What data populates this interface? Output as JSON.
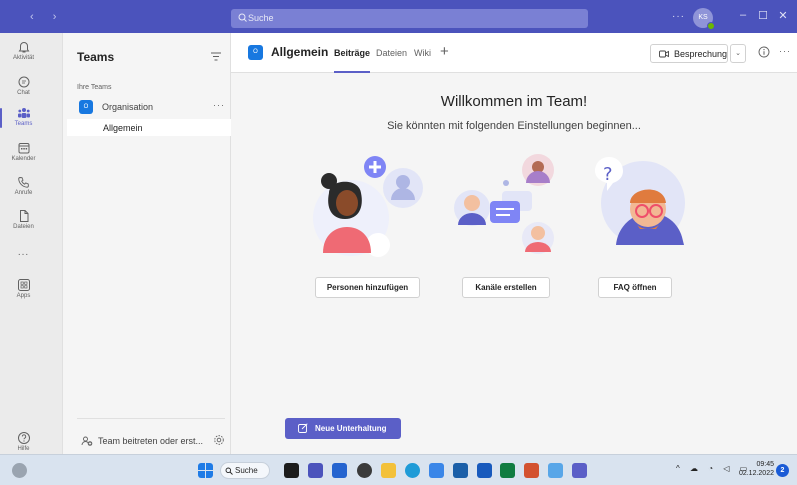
{
  "titlebar": {
    "search_placeholder": "Suche",
    "avatar_initials": "KS",
    "more": "···"
  },
  "rail": {
    "items": [
      {
        "label": "Aktivität",
        "icon": "bell-icon"
      },
      {
        "label": "Chat",
        "icon": "chat-icon"
      },
      {
        "label": "Teams",
        "icon": "teams-icon"
      },
      {
        "label": "Kalender",
        "icon": "calendar-icon"
      },
      {
        "label": "Anrufe",
        "icon": "phone-icon"
      },
      {
        "label": "Dateien",
        "icon": "file-icon"
      },
      {
        "label": "...",
        "icon": "more-icon"
      },
      {
        "label": "Apps",
        "icon": "apps-icon"
      },
      {
        "label": "Hilfe",
        "icon": "help-icon"
      }
    ],
    "active": "Teams"
  },
  "teams_pane": {
    "title": "Teams",
    "section_label": "Ihre Teams",
    "team": {
      "name": "Organisation",
      "tile": "O",
      "more": "···"
    },
    "channel": "Allgemein",
    "join_label": "Team beitreten oder erst..."
  },
  "channel_header": {
    "tile": "O",
    "title": "Allgemein",
    "tabs": [
      "Beiträge",
      "Dateien",
      "Wiki"
    ],
    "active_tab": "Beiträge",
    "add_tab": "+",
    "meeting_button": "Besprechung",
    "more": "···"
  },
  "welcome": {
    "title": "Willkommen im Team!",
    "subtitle": "Sie könnten mit folgenden Einstellungen beginnen...",
    "cards": [
      {
        "button": "Personen hinzufügen"
      },
      {
        "button": "Kanäle erstellen"
      },
      {
        "button": "FAQ öffnen"
      }
    ]
  },
  "compose": {
    "new_conversation": "Neue Unterhaltung"
  },
  "taskbar": {
    "search": "Suche",
    "time": "09:45",
    "date": "02.12.2022",
    "notifications": "2"
  },
  "colors": {
    "accent": "#5b5fc7",
    "titlebar": "#4b53bc",
    "team_tile": "#1878e0"
  }
}
